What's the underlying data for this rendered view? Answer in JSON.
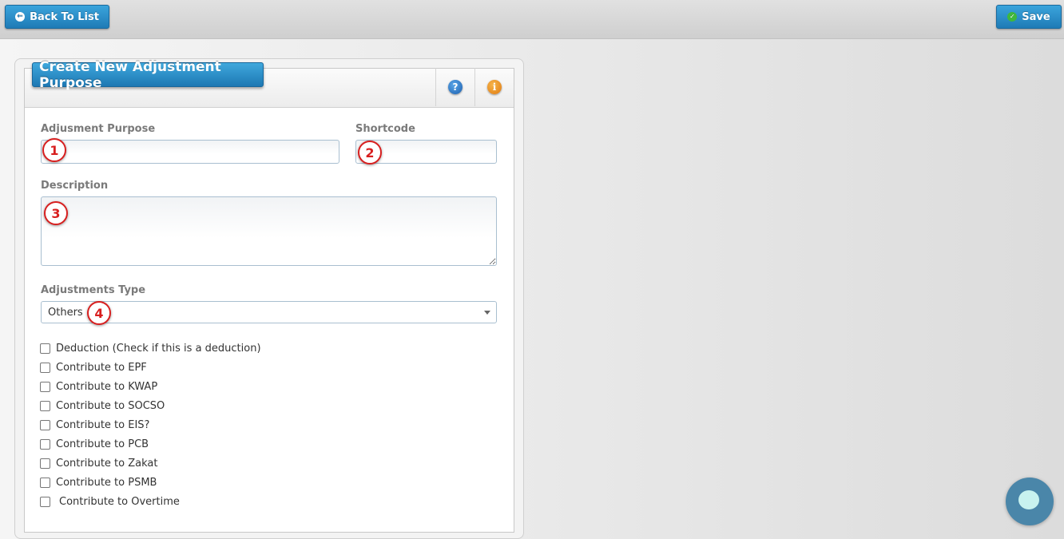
{
  "toolbar": {
    "back_label": "Back To List",
    "save_label": "Save"
  },
  "panel": {
    "title": "Create New Adjustment Purpose",
    "help_icon": "question-mark-icon",
    "info_icon": "info-icon"
  },
  "form": {
    "purpose_label": "Adjusment Purpose",
    "purpose_value": "",
    "shortcode_label": "Shortcode",
    "shortcode_value": "",
    "description_label": "Description",
    "description_value": "",
    "type_label": "Adjustments Type",
    "type_selected": "Others"
  },
  "markers": [
    "1",
    "2",
    "3",
    "4"
  ],
  "checkboxes": [
    {
      "label": "Deduction (Check if this is a deduction)",
      "checked": false
    },
    {
      "label": "Contribute to EPF",
      "checked": false
    },
    {
      "label": "Contribute to KWAP",
      "checked": false
    },
    {
      "label": "Contribute to SOCSO",
      "checked": false
    },
    {
      "label": "Contribute to EIS?",
      "checked": false
    },
    {
      "label": "Contribute to PCB",
      "checked": false
    },
    {
      "label": "Contribute to Zakat",
      "checked": false
    },
    {
      "label": "Contribute to PSMB",
      "checked": false
    },
    {
      "label": "Contribute to Overtime",
      "checked": false
    }
  ],
  "colors": {
    "accent": "#1f7bb6",
    "marker": "#d81f1f",
    "chat": "#4a86a9"
  }
}
